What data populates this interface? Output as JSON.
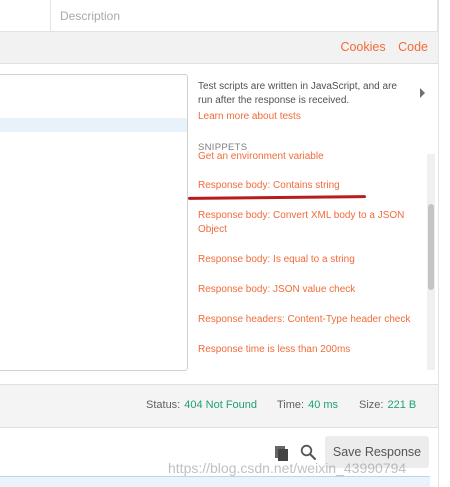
{
  "params": {
    "description_header": "Description"
  },
  "response_links": {
    "cookies": "Cookies",
    "code": "Code"
  },
  "tests_panel": {
    "help_text": "Test scripts are written in JavaScript, and are run after the response is received.",
    "learn_more": "Learn more about tests",
    "snippets_title": "SNIPPETS",
    "snippets": [
      "Get an environment variable",
      "Response body: Contains string",
      "Response body: Convert XML body to a JSON Object",
      "Response body: Is equal to a string",
      "Response body: JSON value check",
      "Response headers: Content-Type header check",
      "Response time is less than 200ms"
    ]
  },
  "status_bar": {
    "status_label": "Status:",
    "status_value": "404 Not Found",
    "time_label": "Time:",
    "time_value": "40 ms",
    "size_label": "Size:",
    "size_value": "221 B",
    "value_color": "#1fa07a"
  },
  "toolbar": {
    "save_response": "Save Response"
  },
  "watermark": "https://blog.csdn.net/weixin_43990794",
  "colors": {
    "accent": "#f26b3a",
    "annotation_line": "#b81d1d"
  }
}
